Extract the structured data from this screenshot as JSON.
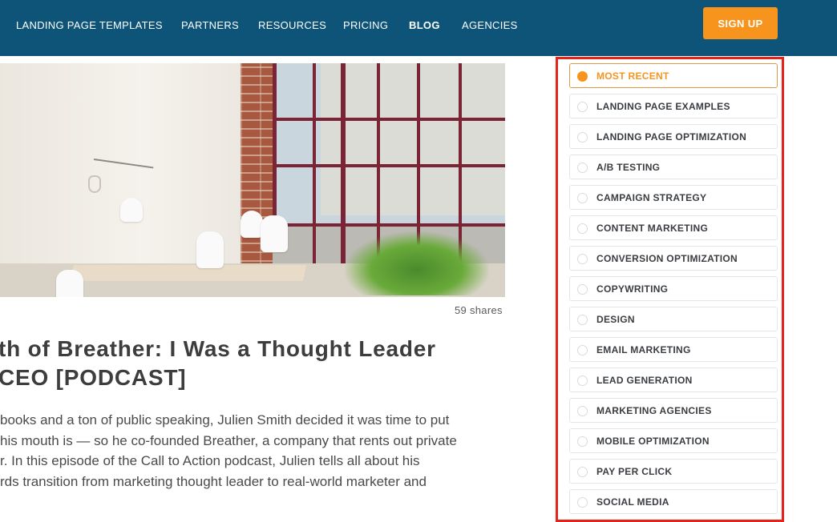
{
  "nav": {
    "items": [
      {
        "label": "LANDING PAGE TEMPLATES",
        "active": false
      },
      {
        "label": "PARTNERS",
        "active": false
      },
      {
        "label": "RESOURCES",
        "active": false
      },
      {
        "label": "PRICING",
        "active": false
      },
      {
        "label": "BLOG",
        "active": true
      },
      {
        "label": "AGENCIES",
        "active": false
      }
    ],
    "signup_label": "SIGN UP"
  },
  "colors": {
    "nav_background": "#0d5478",
    "accent": "#f7941d",
    "highlight_border": "#e5231b"
  },
  "article": {
    "hero_image": "meeting-room-photo",
    "shares": "59 shares",
    "title_lines": [
      "th of Breather: I Was a Thought Leader",
      "CEO [PODCAST]"
    ],
    "excerpt_lines": [
      "books and a ton of public speaking, Julien Smith decided it was time to put",
      "his mouth is — so he co-founded Breather, a company that rents out private",
      "r. In this episode of the Call to Action podcast, Julien tells all about his",
      "rds transition from marketing thought leader to real-world marketer and"
    ]
  },
  "categories": {
    "selected": "MOST RECENT",
    "items": [
      "MOST RECENT",
      "LANDING PAGE EXAMPLES",
      "LANDING PAGE OPTIMIZATION",
      "A/B TESTING",
      "CAMPAIGN STRATEGY",
      "CONTENT MARKETING",
      "CONVERSION OPTIMIZATION",
      "COPYWRITING",
      "DESIGN",
      "EMAIL MARKETING",
      "LEAD GENERATION",
      "MARKETING AGENCIES",
      "MOBILE OPTIMIZATION",
      "PAY PER CLICK",
      "SOCIAL MEDIA"
    ]
  }
}
